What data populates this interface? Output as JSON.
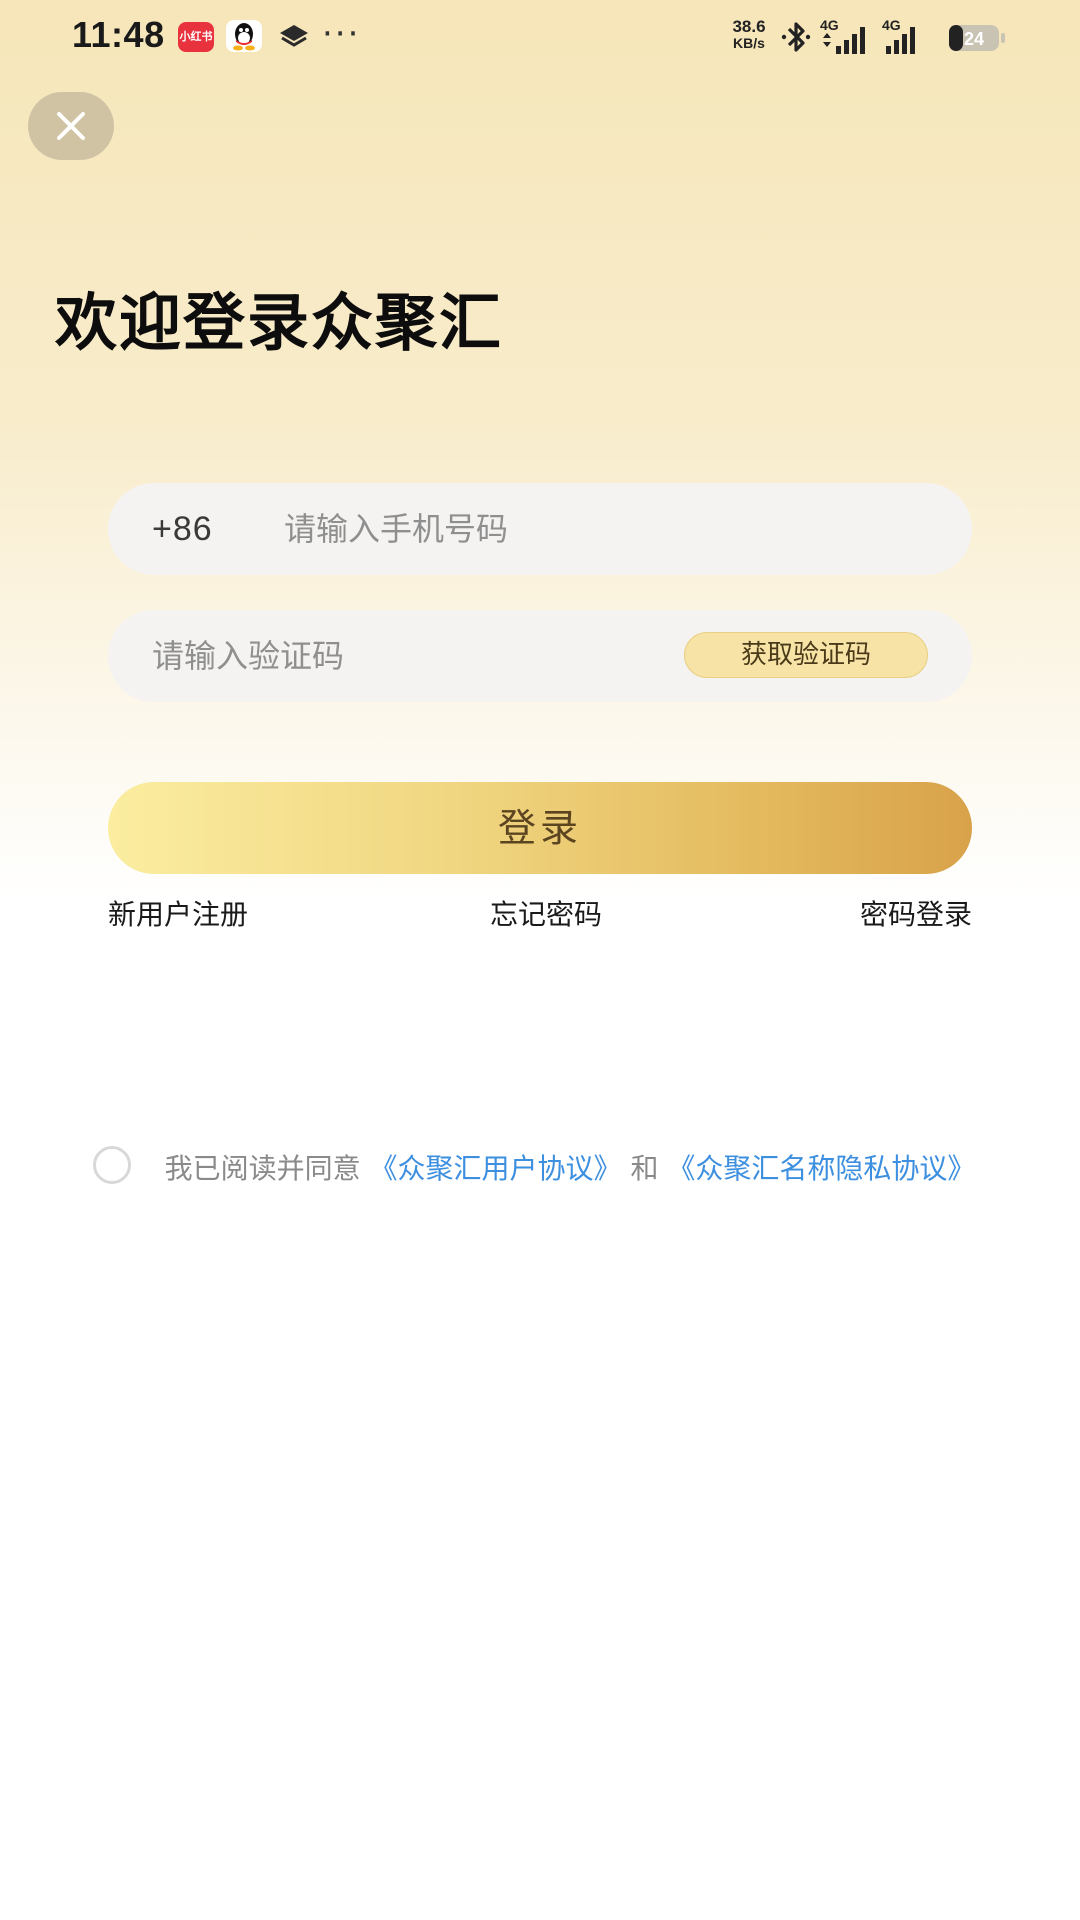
{
  "status_bar": {
    "time": "11:48",
    "app_badge_text": "小红书",
    "net_speed_value": "38.6",
    "net_speed_unit": "KB/s",
    "signal_1_label": "4G",
    "signal_2_label": "4G",
    "battery_level": "24",
    "icons": [
      "xiaohongshu-app-icon",
      "qq-app-icon",
      "layers-icon",
      "more-dots-icon",
      "bluetooth-icon",
      "signal-icon",
      "battery-icon"
    ]
  },
  "header": {
    "close_icon": "close-icon",
    "title": "欢迎登录众聚汇"
  },
  "form": {
    "country_code": "+86",
    "phone_placeholder": "请输入手机号码",
    "phone_value": "",
    "code_placeholder": "请输入验证码",
    "code_value": "",
    "get_code_label": "获取验证码",
    "login_label": "登录"
  },
  "links": {
    "register": "新用户注册",
    "forgot": "忘记密码",
    "password_login": "密码登录"
  },
  "agreement": {
    "prefix": "我已阅读并同意",
    "user_agreement": "《众聚汇用户协议》",
    "and": "和",
    "privacy_agreement": "《众聚汇名称隐私协议》",
    "checked": false
  },
  "colors": {
    "accent_gold": "#d8a24a",
    "link_blue": "#3d8fe0"
  }
}
